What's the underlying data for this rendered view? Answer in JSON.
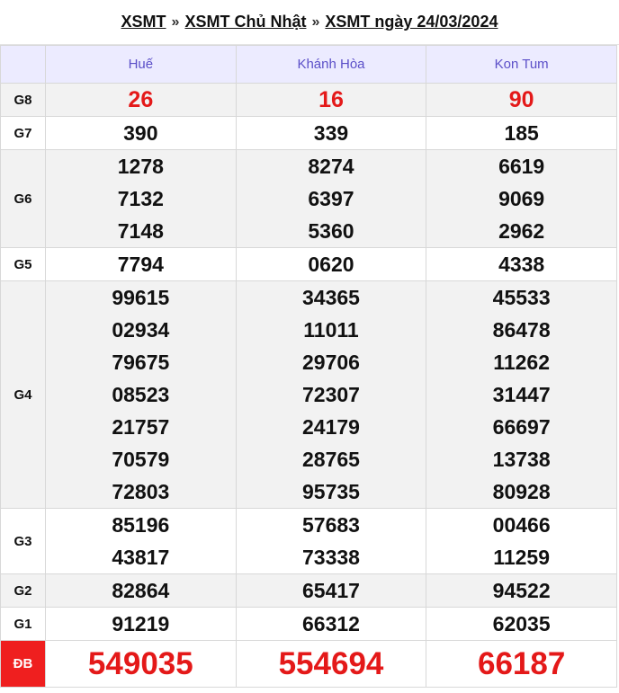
{
  "breadcrumb": {
    "link1": "XSMT",
    "link2": "XSMT Chủ Nhật",
    "link3": "XSMT ngày 24/03/2024",
    "sep": "»"
  },
  "provinces": [
    "Huế",
    "Khánh Hòa",
    "Kon Tum"
  ],
  "prizes": {
    "g8": {
      "label": "G8",
      "values": [
        [
          "26"
        ],
        [
          "16"
        ],
        [
          "90"
        ]
      ]
    },
    "g7": {
      "label": "G7",
      "values": [
        [
          "390"
        ],
        [
          "339"
        ],
        [
          "185"
        ]
      ]
    },
    "g6": {
      "label": "G6",
      "values": [
        [
          "1278",
          "7132",
          "7148"
        ],
        [
          "8274",
          "6397",
          "5360"
        ],
        [
          "6619",
          "9069",
          "2962"
        ]
      ]
    },
    "g5": {
      "label": "G5",
      "values": [
        [
          "7794"
        ],
        [
          "0620"
        ],
        [
          "4338"
        ]
      ]
    },
    "g4": {
      "label": "G4",
      "values": [
        [
          "99615",
          "02934",
          "79675",
          "08523",
          "21757",
          "70579",
          "72803"
        ],
        [
          "34365",
          "11011",
          "29706",
          "72307",
          "24179",
          "28765",
          "95735"
        ],
        [
          "45533",
          "86478",
          "11262",
          "31447",
          "66697",
          "13738",
          "80928"
        ]
      ]
    },
    "g3": {
      "label": "G3",
      "values": [
        [
          "85196",
          "43817"
        ],
        [
          "57683",
          "73338"
        ],
        [
          "00466",
          "11259"
        ]
      ]
    },
    "g2": {
      "label": "G2",
      "values": [
        [
          "82864"
        ],
        [
          "65417"
        ],
        [
          "94522"
        ]
      ]
    },
    "g1": {
      "label": "G1",
      "values": [
        [
          "91219"
        ],
        [
          "66312"
        ],
        [
          "62035"
        ]
      ]
    },
    "db": {
      "label": "ĐB",
      "values": [
        [
          "549035"
        ],
        [
          "554694"
        ],
        [
          "66187"
        ]
      ]
    }
  },
  "colors": {
    "header_bg": "#ecebff",
    "header_text": "#5b4fc8",
    "highlight": "#e41919",
    "db_label_bg": "#ef1f1f",
    "alt_row": "#f2f2f2"
  }
}
